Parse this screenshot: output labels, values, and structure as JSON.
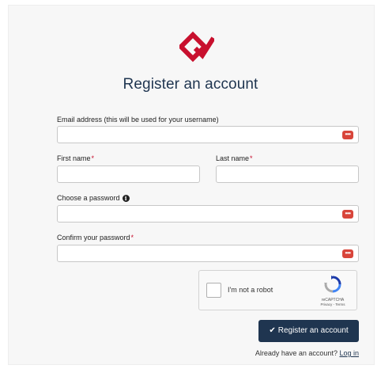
{
  "header": {
    "title": "Register an account"
  },
  "brand": {
    "primary_color": "#c8102e",
    "logo_icon": "brand-logo-icon"
  },
  "form": {
    "email_label": "Email address (this will be used for your username)",
    "first_name_label": "First name",
    "last_name_label": "Last name",
    "password_label": "Choose a password",
    "confirm_label": "Confirm your password",
    "required_mark": "*",
    "info_glyph": "i",
    "password_manager_glyph": "•••"
  },
  "captcha": {
    "label": "I'm not a robot",
    "brand": "reCAPTCHA",
    "links": "Privacy - Terms"
  },
  "actions": {
    "register_check": "✔",
    "register_label": "Register an account",
    "login_prompt": "Already have an account?",
    "login_link": "Log in"
  },
  "colors": {
    "navy": "#1f3550",
    "password_manager_icon": "#d8453a"
  }
}
